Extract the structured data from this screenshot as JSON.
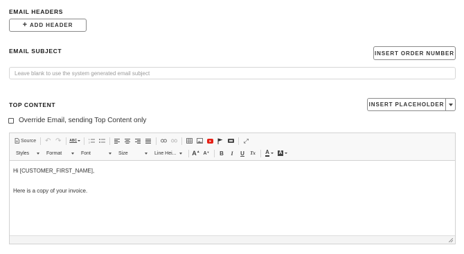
{
  "email_headers": {
    "title": "EMAIL HEADERS",
    "add_button_icon": "+",
    "add_button_label": "ADD HEADER"
  },
  "email_subject": {
    "title": "EMAIL SUBJECT",
    "insert_order_label": "INSERT ORDER NUMBER",
    "placeholder": "Leave blank to use the system generated email subject",
    "value": ""
  },
  "top_content": {
    "title": "TOP CONTENT",
    "insert_placeholder_label": "INSERT PLACEHOLDER",
    "override_label": "Override Email, sending Top Content only",
    "override_checked": false
  },
  "toolbar": {
    "source_label": "Source",
    "combos": {
      "styles": "Styles",
      "format": "Format",
      "font": "Font",
      "size": "Size",
      "line_height": "Line Hei..."
    },
    "icons": [
      "source-icon",
      "undo-icon",
      "redo-icon",
      "spellcheck-icon",
      "numbered-list-icon",
      "bulleted-list-icon",
      "align-left-icon",
      "align-center-icon",
      "align-right-icon",
      "justify-icon",
      "link-icon",
      "unlink-icon",
      "table-icon",
      "image-icon",
      "youtube-icon",
      "flag-icon",
      "iframe-icon",
      "maximize-icon",
      "font-grow-icon",
      "font-shrink-icon",
      "bold-icon",
      "italic-icon",
      "underline-icon",
      "remove-format-icon",
      "text-color-icon",
      "background-color-icon"
    ],
    "glyphs": {
      "undo": "↶",
      "redo": "↷",
      "spell": "ABC",
      "bold": "B",
      "italic": "I",
      "underline": "U",
      "clear": "Tx",
      "grow": "A",
      "shrink": "A",
      "text_color": "A",
      "bg_color": "A",
      "maximize": "⤢"
    },
    "colors": {
      "youtube": "#e62117"
    }
  },
  "editor": {
    "line1": "Hi [CUSTOMER_FIRST_NAME],",
    "line2": "Here is a copy of your invoice."
  }
}
